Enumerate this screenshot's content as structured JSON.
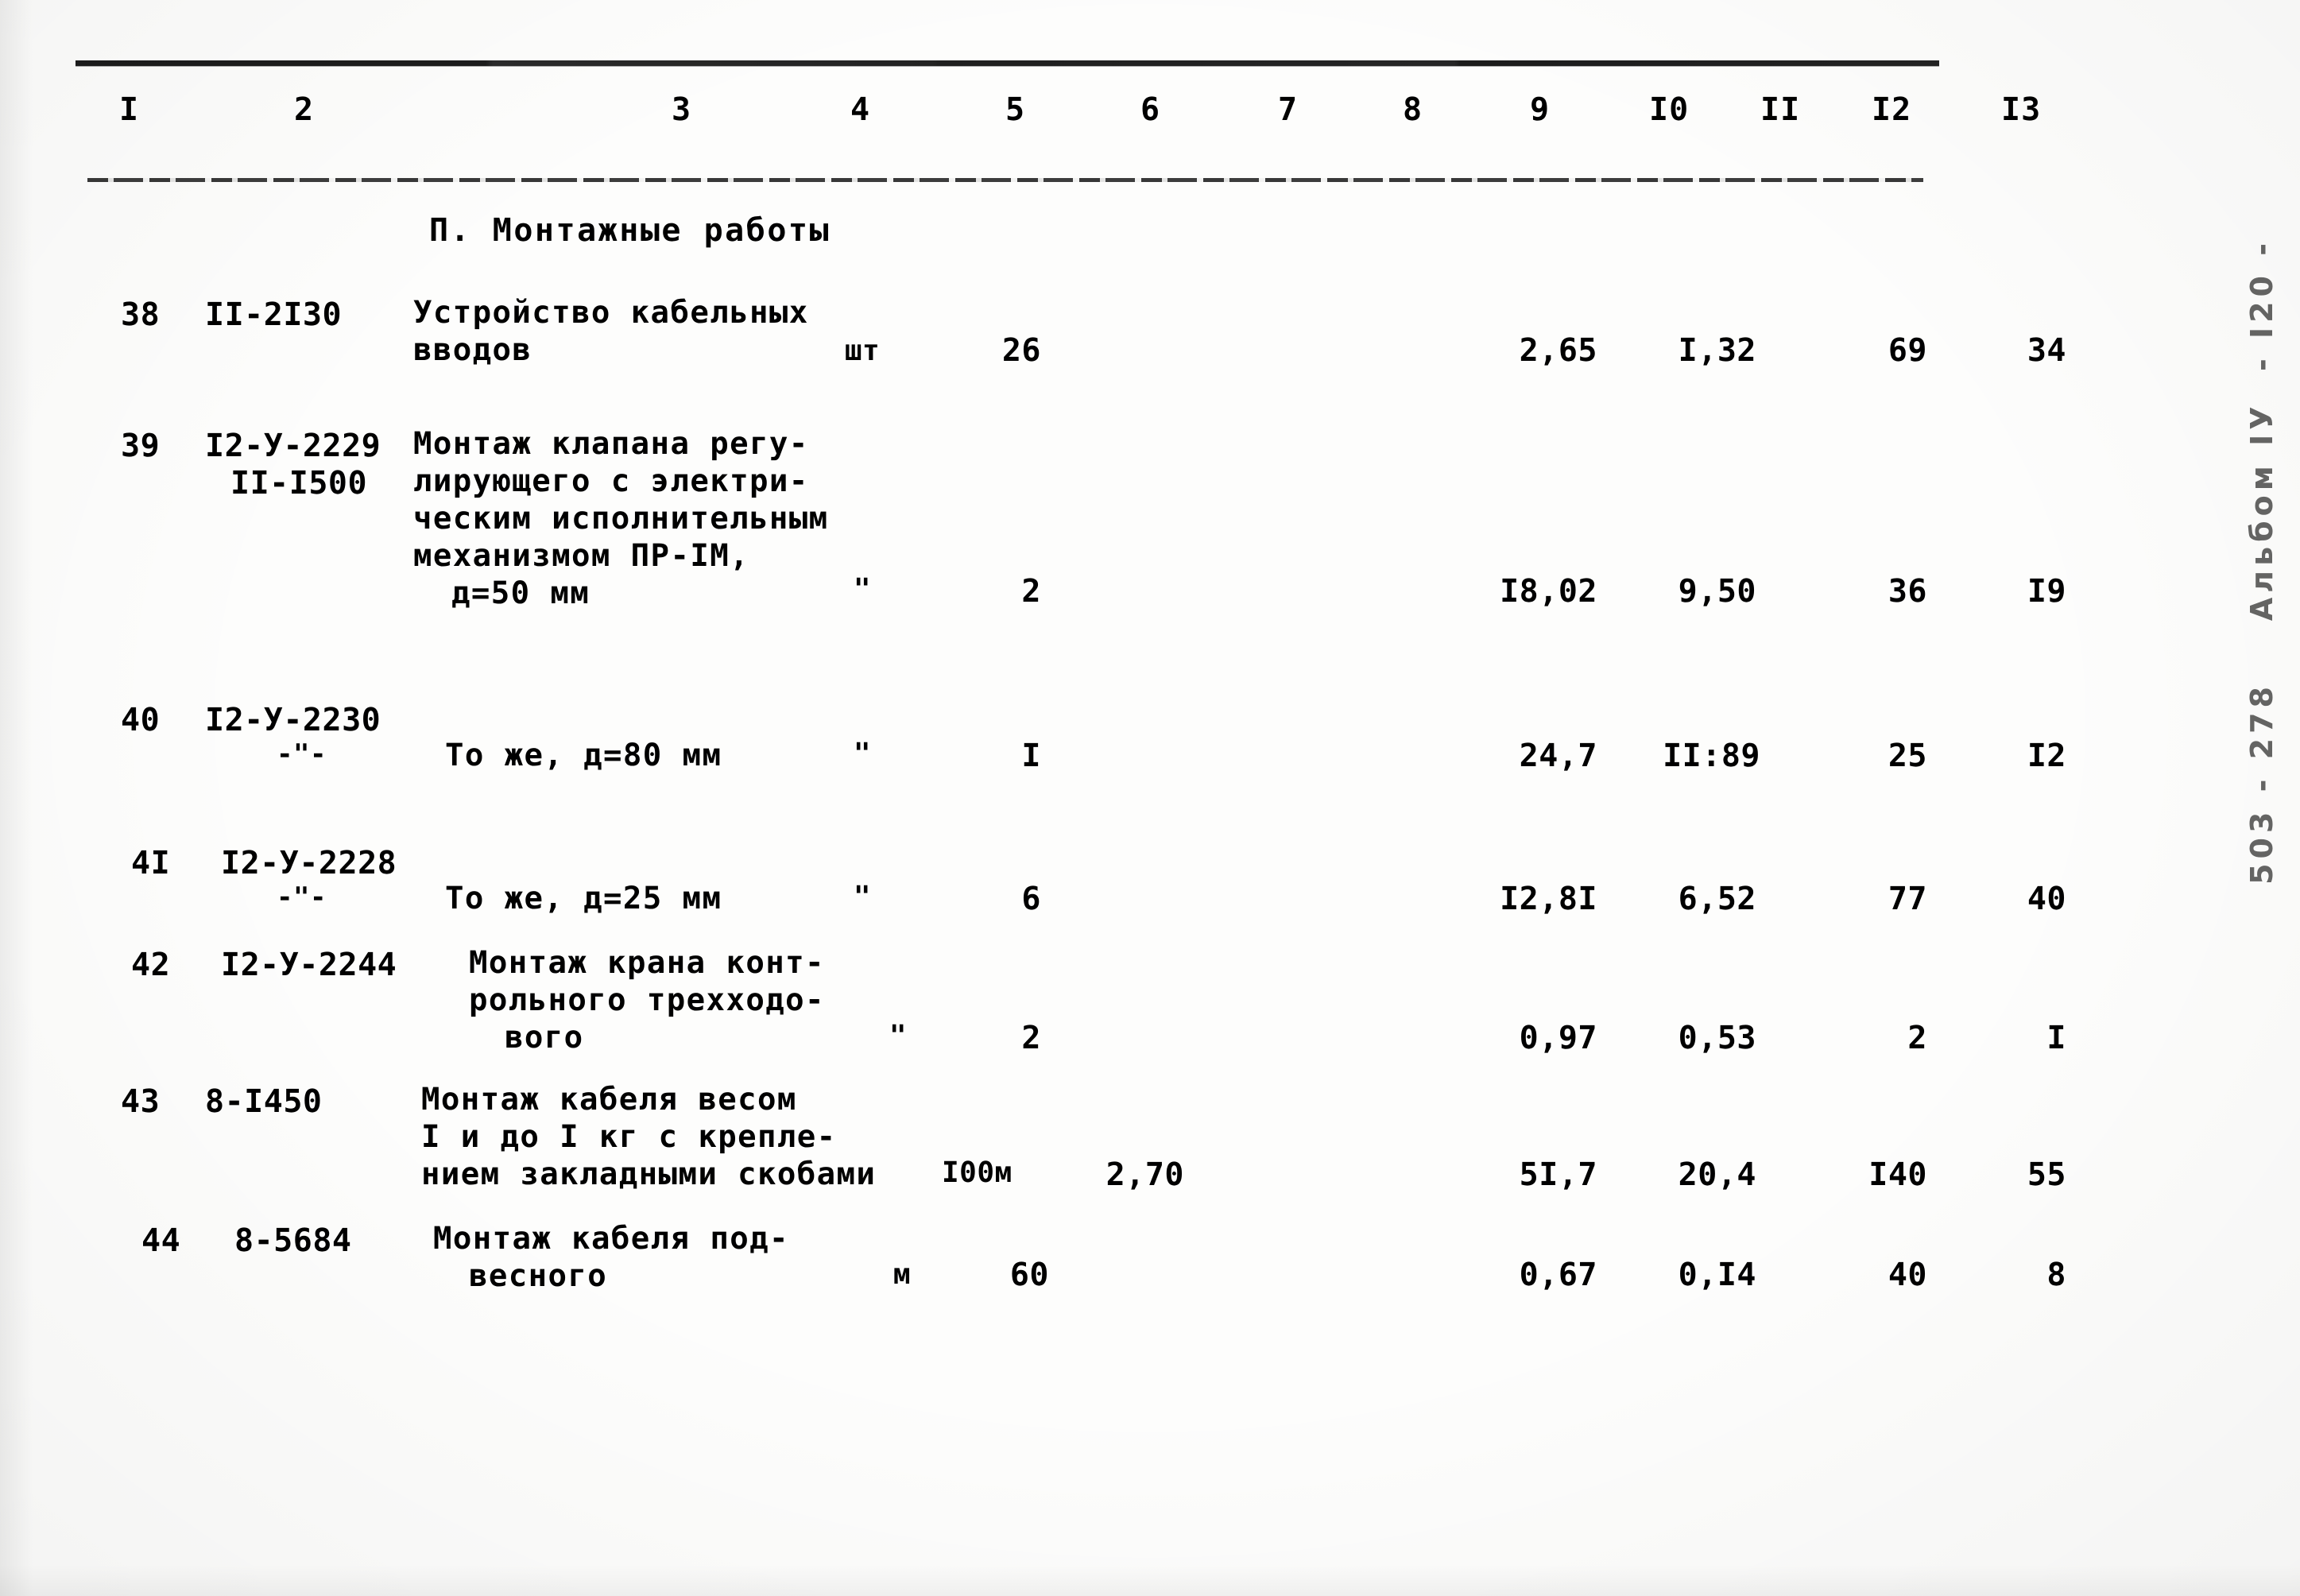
{
  "document": {
    "section_caption": "П. Монтажные работы",
    "margin_note": "503 - 278    Альбом IУ  - I20 -"
  },
  "table": {
    "column_headers": [
      "I",
      "2",
      "3",
      "4",
      "5",
      "6",
      "7",
      "8",
      "9",
      "I0",
      "II",
      "I2",
      "I3"
    ],
    "rows": [
      {
        "no": "38",
        "codes": [
          "II-2I30"
        ],
        "description": [
          "Устройство кабельных",
          "вводов"
        ],
        "unit": "шт",
        "qty": "26",
        "c6": "",
        "c7": "",
        "c8": "",
        "c9": "2,65",
        "c10": "I,32",
        "c11": "",
        "c12": "69",
        "c13": "34"
      },
      {
        "no": "39",
        "codes": [
          "I2-У-2229",
          "II-I500"
        ],
        "description": [
          "Монтаж клапана регу-",
          "лирующего с электри-",
          "ческим исполнительным",
          "механизмом ПР-IМ,",
          "д=50 мм"
        ],
        "unit": "\"",
        "qty": "2",
        "c6": "",
        "c7": "",
        "c8": "",
        "c9": "I8,02",
        "c10": "9,50",
        "c11": "",
        "c12": "36",
        "c13": "I9"
      },
      {
        "no": "40",
        "codes": [
          "I2-У-2230",
          "-\"-"
        ],
        "description": [
          "То же, д=80 мм"
        ],
        "unit": "\"",
        "qty": "I",
        "c6": "",
        "c7": "",
        "c8": "",
        "c9": "24,7",
        "c10": "II:89",
        "c11": "",
        "c12": "25",
        "c13": "I2"
      },
      {
        "no": "4I",
        "codes": [
          "I2-У-2228",
          "-\"-"
        ],
        "description": [
          "То же, д=25 мм"
        ],
        "unit": "\"",
        "qty": "6",
        "c6": "",
        "c7": "",
        "c8": "",
        "c9": "I2,8I",
        "c10": "6,52",
        "c11": "",
        "c12": "77",
        "c13": "40"
      },
      {
        "no": "42",
        "codes": [
          "I2-У-2244"
        ],
        "description": [
          "Монтаж крана конт-",
          "рольного трехходо-",
          "вого"
        ],
        "unit": "\"",
        "qty": "2",
        "c6": "",
        "c7": "",
        "c8": "",
        "c9": "0,97",
        "c10": "0,53",
        "c11": "",
        "c12": "2",
        "c13": "I"
      },
      {
        "no": "43",
        "codes": [
          "8-I450"
        ],
        "description": [
          "Монтаж кабеля весом",
          "I и до I кг с крепле-",
          "нием закладными скобами"
        ],
        "unit": "I00м",
        "qty": "2,70",
        "c6": "",
        "c7": "",
        "c8": "",
        "c9": "5I,7",
        "c10": "20,4",
        "c11": "",
        "c12": "I40",
        "c13": "55"
      },
      {
        "no": "44",
        "codes": [
          "8-5684"
        ],
        "description": [
          "Монтаж кабеля под-",
          "весного"
        ],
        "unit": "м",
        "qty": "60",
        "c6": "",
        "c7": "",
        "c8": "",
        "c9": "0,67",
        "c10": "0,I4",
        "c11": "",
        "c12": "40",
        "c13": "8"
      }
    ]
  }
}
